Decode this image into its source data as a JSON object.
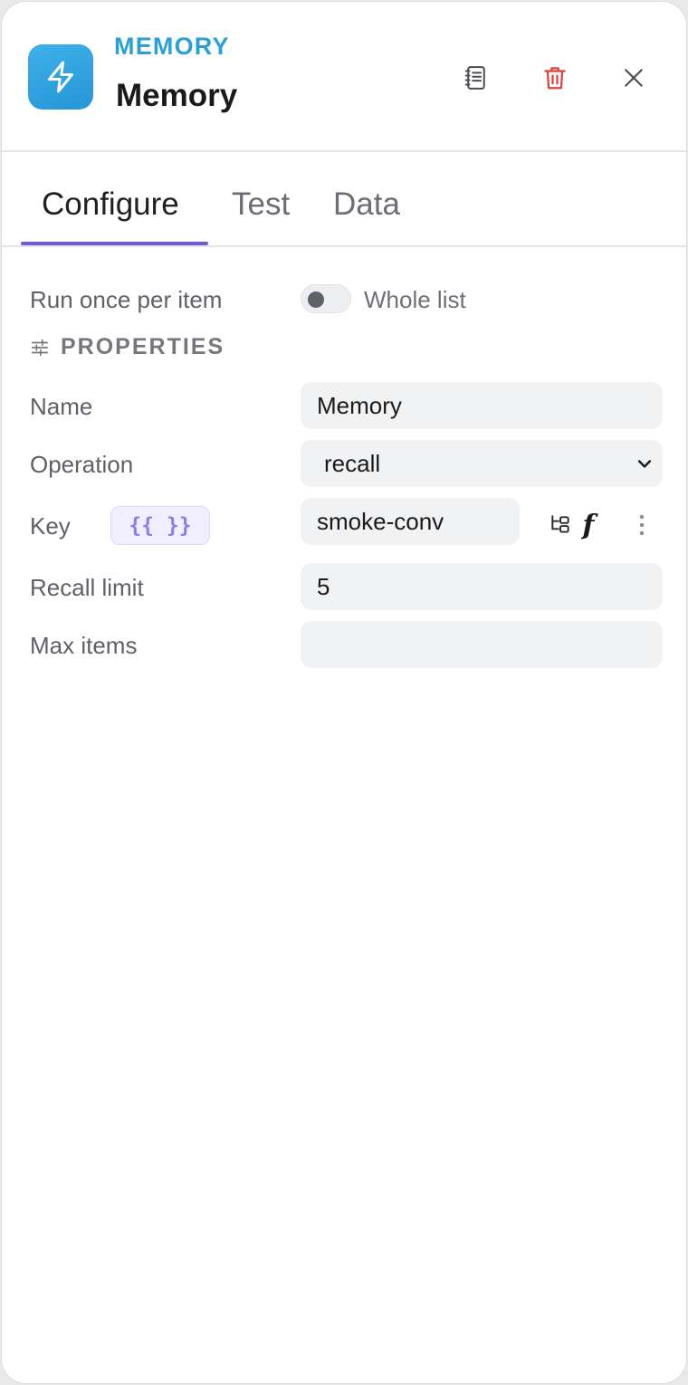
{
  "header": {
    "node_type": "MEMORY",
    "node_title": "Memory",
    "icon": "lightning-bolt-icon",
    "accent_color": "#2aa0d8"
  },
  "tabs": [
    {
      "label": "Configure",
      "active": true
    },
    {
      "label": "Test",
      "active": false
    },
    {
      "label": "Data",
      "active": false
    }
  ],
  "run_mode": {
    "label": "Run once per item",
    "toggle_label": "Whole list",
    "toggle_on": false
  },
  "properties": {
    "section_title": "PROPERTIES",
    "name": {
      "label": "Name",
      "value": "Memory"
    },
    "operation": {
      "label": "Operation",
      "value": "recall"
    },
    "key": {
      "label": "Key",
      "expression_badge": "{{ }}",
      "value": "smoke-conv",
      "function_glyph": "f"
    },
    "recall_limit": {
      "label": "Recall limit",
      "value": "5"
    },
    "max_items": {
      "label": "Max items",
      "value": ""
    }
  },
  "colors": {
    "tab_underline": "#6a5bd8",
    "delete_icon": "#d9453d"
  }
}
